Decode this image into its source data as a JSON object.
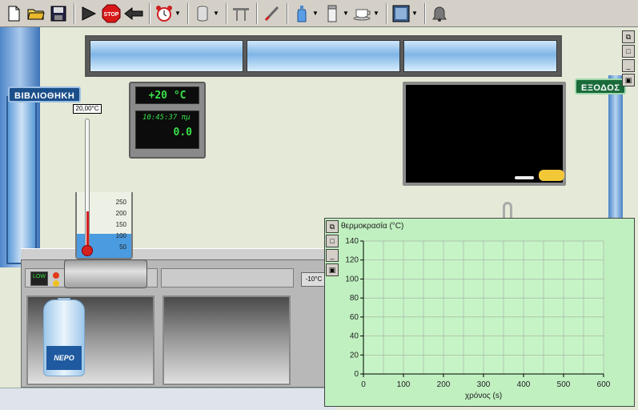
{
  "toolbar": {
    "buttons": [
      {
        "icon": "new-file-icon"
      },
      {
        "icon": "open-folder-icon"
      },
      {
        "icon": "save-icon"
      },
      {
        "icon": "play-icon"
      },
      {
        "icon": "stop-icon",
        "label": "STOP"
      },
      {
        "icon": "back-arrow-icon"
      },
      {
        "icon": "alarm-clock-icon"
      },
      {
        "icon": "beaker-icon"
      },
      {
        "icon": "stand-icon"
      },
      {
        "icon": "thermometer-icon"
      },
      {
        "icon": "bottle-icon"
      },
      {
        "icon": "jar-icon"
      },
      {
        "icon": "cup-icon"
      },
      {
        "icon": "picture-icon"
      },
      {
        "icon": "bell-icon"
      }
    ]
  },
  "scene": {
    "library_sign": "ΒΙΒΛΙΟΘΗΚΗ",
    "exit_sign": "ΕΞΟΔΟΣ",
    "room_temp": "+20 °C",
    "clock_time": "10:45:37 πμ",
    "clock_value": "0.0",
    "thermometer_reading": "20,00°C",
    "beaker_ticks": [
      "250",
      "200",
      "150",
      "100",
      "50"
    ],
    "low_label": "LOW",
    "bottle_label": "ΝΕΡΟ",
    "fridge_temp": "-10°C"
  },
  "graph": {
    "y_label": "θερμοκρασία (°C)",
    "x_label": "χρόνος (s)"
  },
  "chart_data": {
    "type": "line",
    "title": "",
    "xlabel": "χρόνος (s)",
    "ylabel": "θερμοκρασία (°C)",
    "xlim": [
      0,
      600
    ],
    "ylim": [
      0,
      140
    ],
    "x_ticks": [
      0,
      100,
      200,
      300,
      400,
      500,
      600
    ],
    "y_ticks": [
      0,
      20,
      40,
      60,
      80,
      100,
      120,
      140
    ],
    "grid": true,
    "series": []
  },
  "colors": {
    "graph_bg": "#c0f0c0",
    "grid": "#9a9a9a",
    "display_text": "#39e04a"
  }
}
